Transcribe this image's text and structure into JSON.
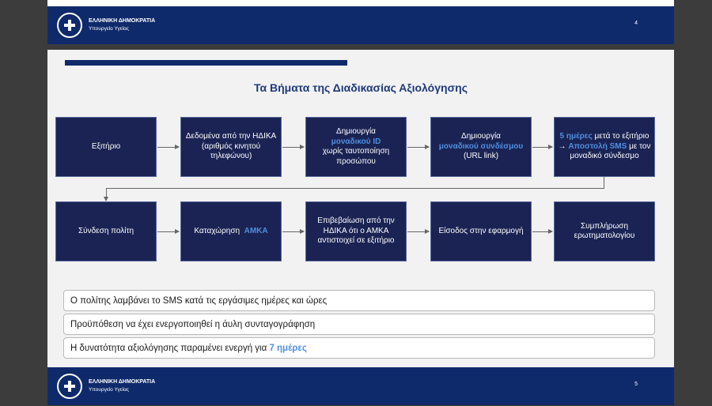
{
  "footer": {
    "org_name": "ΕΛΛΗΝΙΚΗ ΔΗΜΟΚΡΑΤΙΑ",
    "org_sub": "Υπουργείο Υγείας"
  },
  "prev_slide": {
    "page_number": "4"
  },
  "slide": {
    "page_number": "5",
    "title": "Τα Βήματα της Διαδικασίας Αξιολόγησης",
    "steps_row1": [
      {
        "text": "Εξιτήριο"
      },
      {
        "text": "Δεδομένα από την ΗΔΙΚΑ (αριθμός κινητού τηλεφώνου)"
      },
      {
        "line1": "Δημιουργία",
        "highlight": "μοναδικού ID",
        "rest": "χωρίς ταυτοποίηση προσώπου"
      },
      {
        "line1": "Δημιουργία",
        "highlight": "μοναδικού συνδέσμου",
        "rest": "(URL link)"
      },
      {
        "hl1": "5 ημέρες",
        "t1": "μετά το εξιτήριο →",
        "hl2": "Αποστολή SMS",
        "t2": "με τον μοναδικό σύνδεσμο"
      }
    ],
    "steps_row2": [
      {
        "text": "Σύνδεση πολίτη"
      },
      {
        "text": "Καταχώρηση",
        "highlight": "ΑΜΚΑ"
      },
      {
        "text": "Επιβεβαίωση από την ΗΔΙΚΑ ότι ο ΑΜΚΑ αντιστοιχεί σε εξιτήριο"
      },
      {
        "text": "Είσοδος στην εφαρμογή"
      },
      {
        "text": "Συμπλήρωση ερωτηματολογίου"
      }
    ],
    "notes": [
      {
        "text": "Ο πολίτης λαμβάνει το SMS κατά τις εργάσιμες ημέρες και ώρες"
      },
      {
        "text": "Προϋπόθεση να έχει ενεργοποιηθεί η άυλη συνταγογράφηση"
      },
      {
        "text": "Η δυνατότητα αξιολόγησης παραμένει ενεργή για",
        "highlight": "7 ημέρες"
      }
    ]
  }
}
